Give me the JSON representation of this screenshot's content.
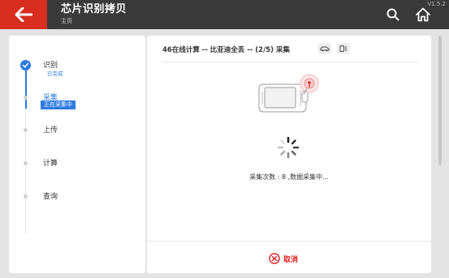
{
  "header": {
    "title": "芯片识别拷贝",
    "subtitle": "主页",
    "version": "V1.5.2"
  },
  "steps": [
    {
      "label": "识别",
      "status": "已完成",
      "state": "done"
    },
    {
      "label": "采集",
      "status": "正在采集中",
      "state": "active"
    },
    {
      "label": "上传",
      "status": "",
      "state": "pending"
    },
    {
      "label": "计算",
      "status": "",
      "state": "pending"
    },
    {
      "label": "查询",
      "status": "",
      "state": "pending"
    }
  ],
  "main": {
    "title": "46在线计算 -- 比亚迪全丢 -- (2/5) 采集",
    "progress_text": "采集次数 : 8 ,数据采集中...",
    "cancel_label": "取消"
  },
  "icons": {
    "back": "arrow-left-icon",
    "search": "search-icon",
    "home": "home-icon",
    "car": "car-icon",
    "key": "key-device-icon",
    "cancel": "close-circle-icon"
  },
  "colors": {
    "brand_red": "#d92d20",
    "accent_blue": "#2d7be0",
    "topbar": "#3a3a3a"
  }
}
